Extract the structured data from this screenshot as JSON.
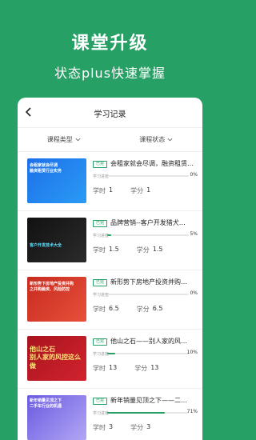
{
  "hero": {
    "title": "课堂升级",
    "subtitle": "状态plus快速掌握"
  },
  "navbar": {
    "title": "学习记录"
  },
  "filters": [
    {
      "label": "课程类型"
    },
    {
      "label": "课程状态"
    }
  ],
  "labels": {
    "badge": "已完",
    "progress": "学习进度",
    "hours": "学时",
    "credits": "学分"
  },
  "courses": [
    {
      "title": "会租家就会尽调，融资租赁…",
      "progress_pct": 0,
      "progress_text": "0%",
      "hours": "1",
      "credits": "1",
      "thumb_caption": "会租家就会尽调\n融资租赁行业实务",
      "thumb_theme": "blue"
    },
    {
      "title": "品牌营销--客户开发猎犬…",
      "progress_pct": 5,
      "progress_text": "5%",
      "hours": "1.5",
      "credits": "1.5",
      "thumb_caption": "客户开发技术大全",
      "thumb_theme": "dark"
    },
    {
      "title": "新形势下房地产投资并购…",
      "progress_pct": 0,
      "progress_text": "0%",
      "hours": "6.5",
      "credits": "6.5",
      "thumb_caption": "新形势下房地产投资并购\n之并购融资、风险防控",
      "thumb_theme": "red"
    },
    {
      "title": "他山之石——别人家的风…",
      "progress_pct": 10,
      "progress_text": "10%",
      "hours": "13",
      "credits": "13",
      "thumb_caption": "他山之石\n别人家的风控这么做",
      "thumb_theme": "crimson"
    },
    {
      "title": "新年销量见顶之下——二…",
      "progress_pct": 71,
      "progress_text": "71%",
      "hours": "3",
      "credits": "3",
      "thumb_caption": "新年销量见顶之下\n二手车行业的机遇",
      "thumb_theme": "purple"
    }
  ]
}
